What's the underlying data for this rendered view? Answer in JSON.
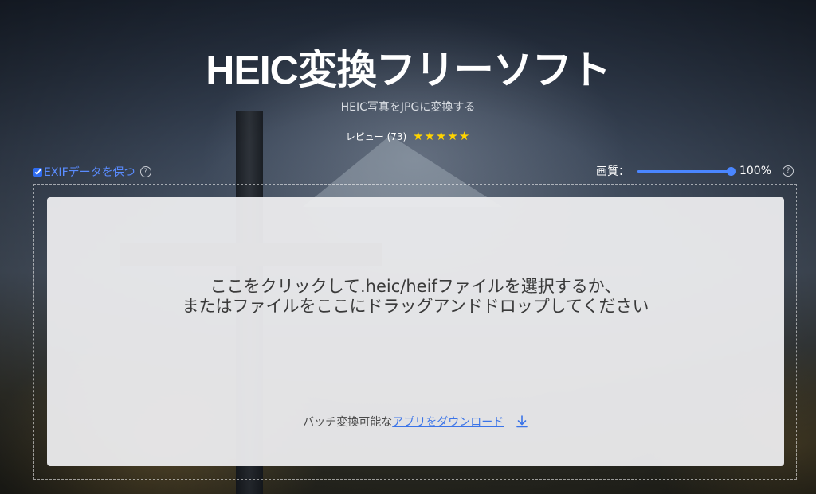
{
  "header": {
    "title": "HEIC変換フリーソフト",
    "subtitle": "HEIC写真をJPGに変換する",
    "review_label": "レビュー",
    "review_count": "(73)",
    "stars": "★★★★★",
    "rating": 5
  },
  "options": {
    "exif_label": "EXIFデータを保つ",
    "exif_checked": true,
    "quality_label": "画質：",
    "quality_value": "100%",
    "quality_level": 1.0
  },
  "dropzone": {
    "line1": "ここをクリックして.heic/heifファイルを選択するか、",
    "line2": "またはファイルをここにドラッグアンドドロップしてください",
    "batch_prefix": "バッチ変換可能な",
    "batch_link": "アプリをダウンロード"
  },
  "icons": {
    "help": "help-circle-icon",
    "download": "download-icon",
    "star": "star-icon"
  },
  "colors": {
    "accent": "#4a86ff",
    "link": "#3b74e8",
    "star": "#ffd400"
  }
}
